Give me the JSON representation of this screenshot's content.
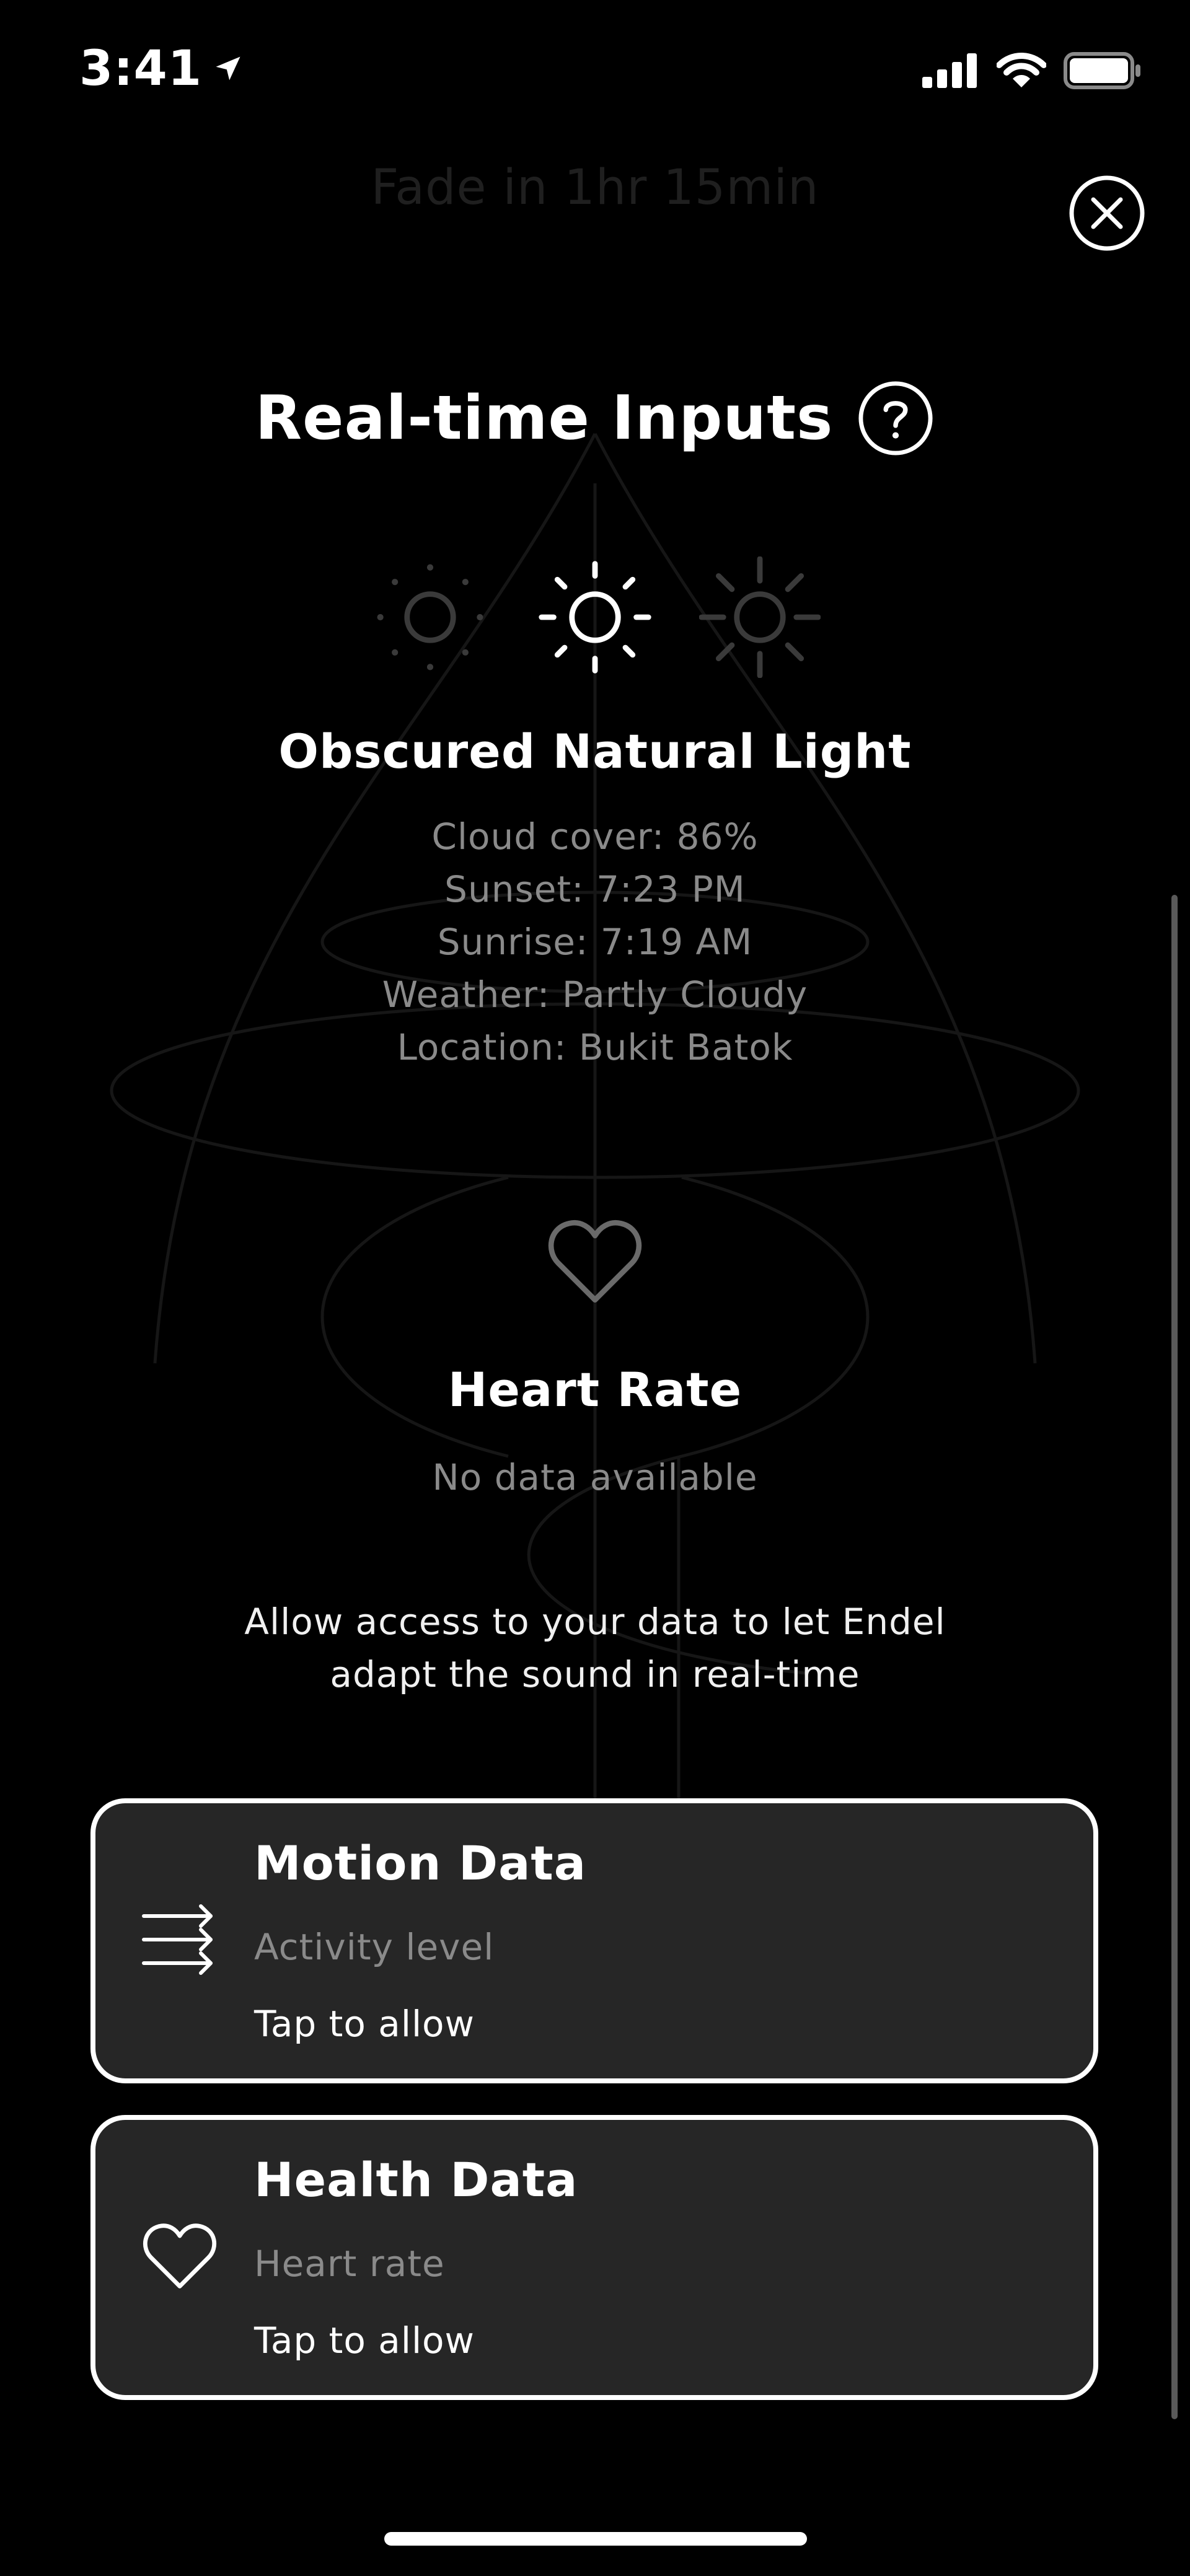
{
  "status_bar": {
    "time": "3:41",
    "icons": [
      "location-arrow-icon",
      "cellular-signal-icon",
      "wifi-icon",
      "battery-icon"
    ]
  },
  "header": {
    "fade_label": "Fade in 1hr 15min",
    "close_icon": "close-icon"
  },
  "realtime": {
    "title": "Real-time Inputs",
    "help_icon": "help-icon",
    "light_levels": [
      "dim-sun-icon",
      "medium-sun-icon",
      "bright-sun-icon"
    ],
    "active_light_level": 1
  },
  "light": {
    "title": "Obscured Natural Light",
    "details": [
      "Cloud cover: 86%",
      "Sunset: 7:23 PM",
      "Sunrise: 7:19 AM",
      "Weather: Partly Cloudy",
      "Location: Bukit Batok"
    ]
  },
  "heart_rate": {
    "icon": "heart-icon",
    "title": "Heart Rate",
    "status": "No data available"
  },
  "allow_text": "Allow access to your data to let Endel adapt the sound in real-time",
  "permissions": [
    {
      "icon": "motion-arrows-icon",
      "title": "Motion Data",
      "subtitle": "Activity level",
      "action": "Tap to allow"
    },
    {
      "icon": "heart-icon",
      "title": "Health Data",
      "subtitle": "Heart rate",
      "action": "Tap to allow"
    }
  ],
  "colors": {
    "background": "#000000",
    "card_background": "#262626",
    "secondary_text": "#8a8a8a",
    "faded_text": "#1f1f1f"
  }
}
